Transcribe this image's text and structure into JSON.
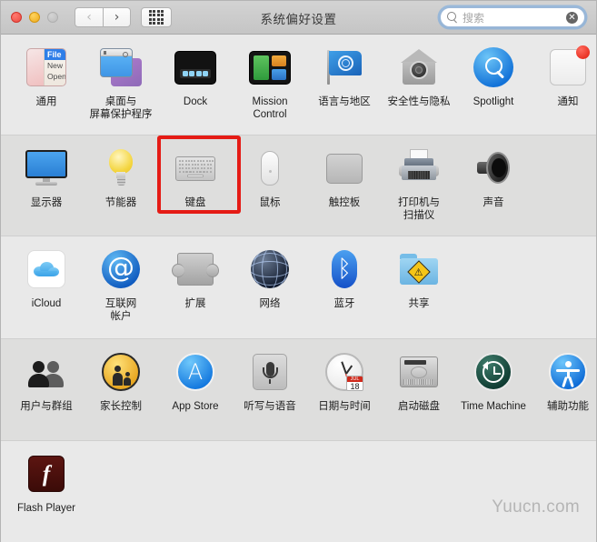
{
  "window": {
    "title": "系统偏好设置",
    "traffic_lights": [
      "close",
      "minimize",
      "zoom"
    ],
    "nav": {
      "back": "‹",
      "forward": "›",
      "grid": "show-all"
    },
    "search": {
      "placeholder": "搜索",
      "value": "",
      "clear": "✕"
    }
  },
  "watermark": "Yuucn.com",
  "selected_item": "键盘",
  "accent_color": "#e51b15",
  "rows": [
    {
      "id": "row-personal",
      "items": [
        {
          "label": "通用",
          "icon": "general-icon"
        },
        {
          "label": "桌面与\n屏幕保护程序",
          "icon": "desktop-screensaver-icon"
        },
        {
          "label": "Dock",
          "icon": "dock-icon"
        },
        {
          "label": "Mission\nControl",
          "icon": "mission-control-icon"
        },
        {
          "label": "语言与地区",
          "icon": "language-region-icon"
        },
        {
          "label": "安全性与隐私",
          "icon": "security-privacy-icon"
        },
        {
          "label": "Spotlight",
          "icon": "spotlight-icon"
        },
        {
          "label": "通知",
          "icon": "notifications-icon"
        }
      ]
    },
    {
      "id": "row-hardware",
      "items": [
        {
          "label": "显示器",
          "icon": "displays-icon"
        },
        {
          "label": "节能器",
          "icon": "energy-saver-icon"
        },
        {
          "label": "键盘",
          "icon": "keyboard-icon"
        },
        {
          "label": "鼠标",
          "icon": "mouse-icon"
        },
        {
          "label": "触控板",
          "icon": "trackpad-icon"
        },
        {
          "label": "打印机与\n扫描仪",
          "icon": "printers-scanners-icon"
        },
        {
          "label": "声音",
          "icon": "sound-icon"
        }
      ]
    },
    {
      "id": "row-internet",
      "items": [
        {
          "label": "iCloud",
          "icon": "icloud-icon"
        },
        {
          "label": "互联网\n帐户",
          "icon": "internet-accounts-icon"
        },
        {
          "label": "扩展",
          "icon": "extensions-icon"
        },
        {
          "label": "网络",
          "icon": "network-icon"
        },
        {
          "label": "蓝牙",
          "icon": "bluetooth-icon"
        },
        {
          "label": "共享",
          "icon": "sharing-icon"
        }
      ]
    },
    {
      "id": "row-system",
      "items": [
        {
          "label": "用户与群组",
          "icon": "users-groups-icon"
        },
        {
          "label": "家长控制",
          "icon": "parental-controls-icon"
        },
        {
          "label": "App Store",
          "icon": "app-store-icon"
        },
        {
          "label": "听写与语音",
          "icon": "dictation-speech-icon"
        },
        {
          "label": "日期与时间",
          "icon": "date-time-icon"
        },
        {
          "label": "启动磁盘",
          "icon": "startup-disk-icon"
        },
        {
          "label": "Time Machine",
          "icon": "time-machine-icon"
        },
        {
          "label": "辅助功能",
          "icon": "accessibility-icon"
        }
      ]
    },
    {
      "id": "row-other",
      "items": [
        {
          "label": "Flash Player",
          "icon": "flash-player-icon"
        }
      ]
    }
  ],
  "icon_details": {
    "general_menu": {
      "header": "File",
      "items": [
        "New",
        "Open"
      ]
    },
    "date_time_calendar": {
      "month": "JUL",
      "day": "18"
    },
    "internet_accounts_glyph": "@",
    "bluetooth_glyph": "ᛒ",
    "app_store_glyph": "A",
    "flash_glyph": "f",
    "sharing_sign_glyph": "⚠"
  }
}
